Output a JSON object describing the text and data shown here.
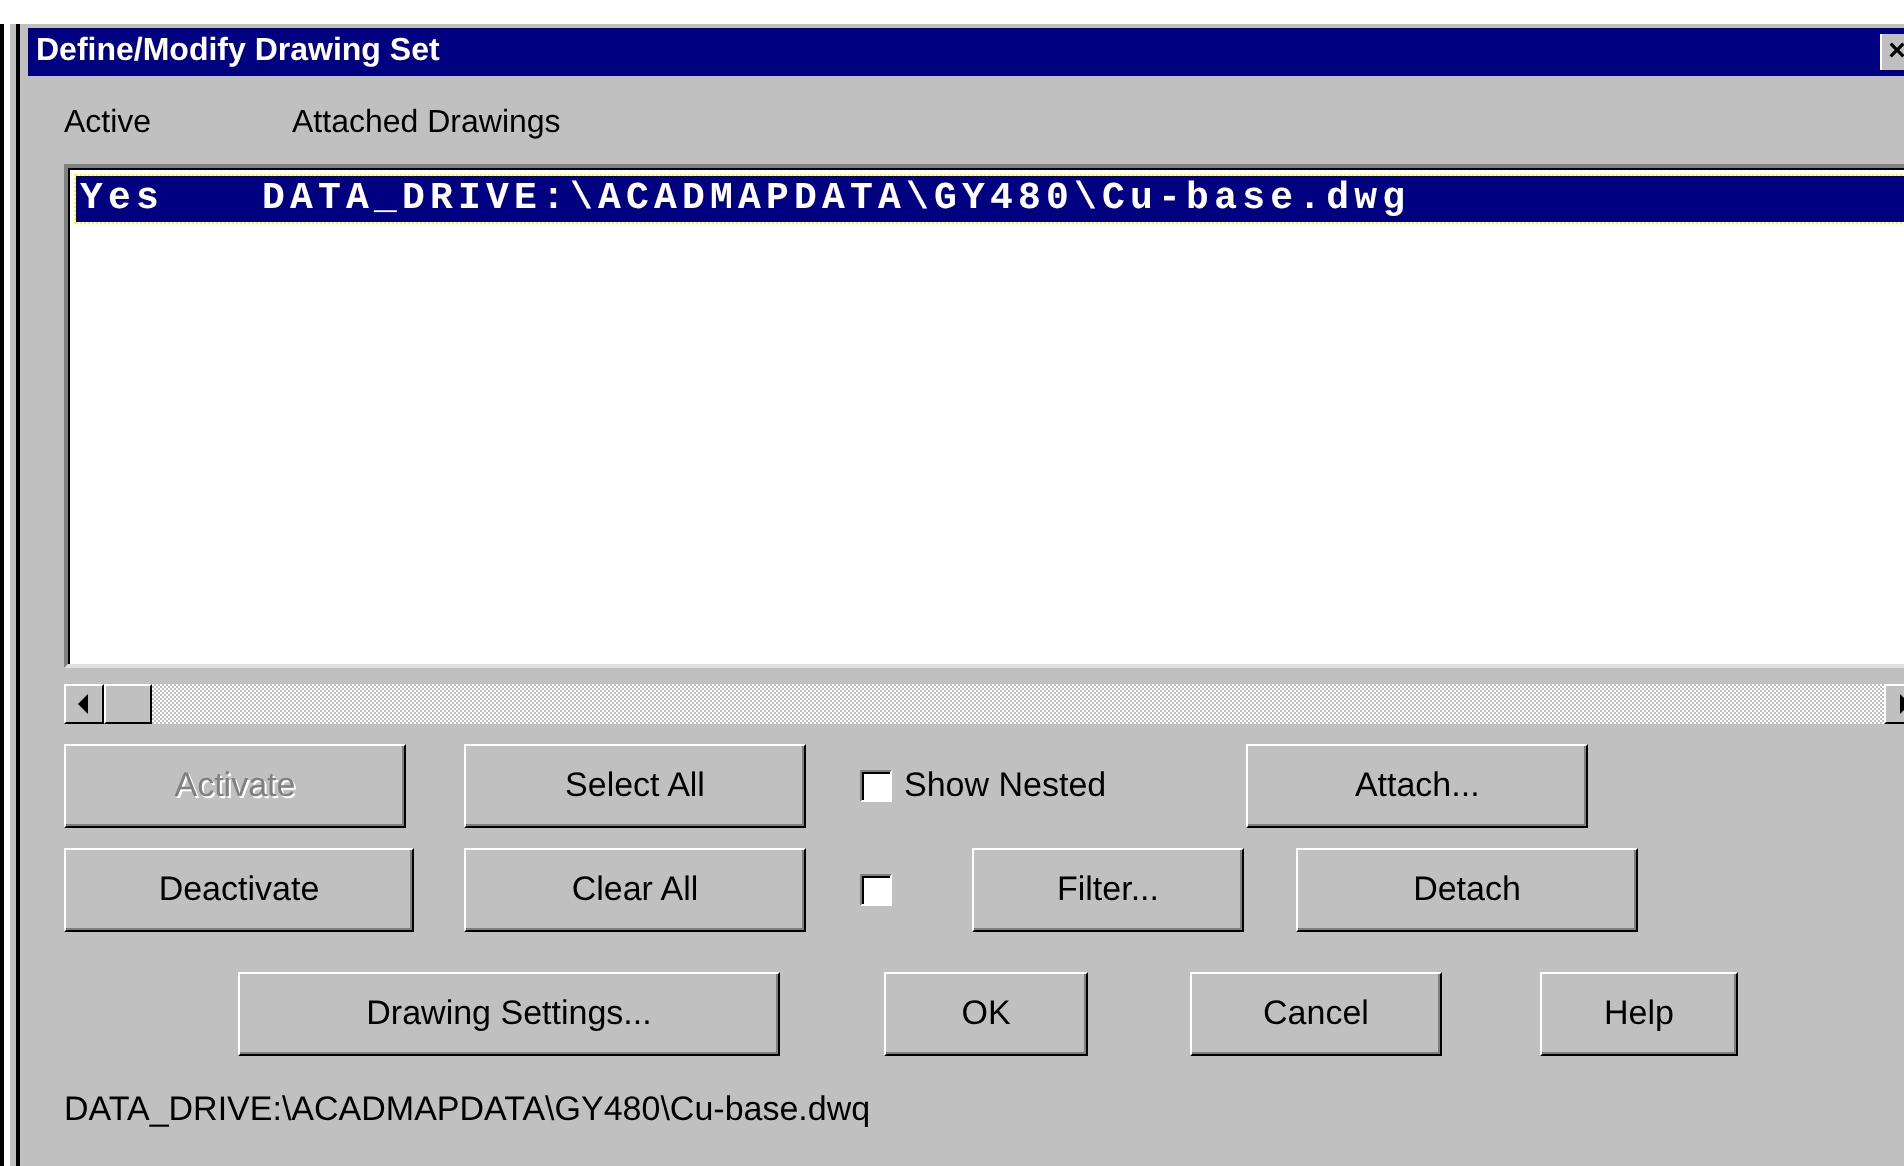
{
  "window": {
    "title": "Define/Modify Drawing Set",
    "close": "×"
  },
  "list": {
    "columns": [
      "Active",
      "Attached Drawings"
    ],
    "rows": [
      {
        "active": "Yes",
        "path": "DATA_DRIVE:\\ACADMAPDATA\\GY480\\Cu-base.dwg",
        "selected": true
      }
    ]
  },
  "controls": [
    [
      {
        "kind": "button",
        "label": "Activate",
        "disabled": true
      },
      {
        "kind": "button",
        "label": "Select All",
        "disabled": false
      },
      {
        "kind": "checkbox",
        "label": "Show Nested",
        "checked": false
      },
      {
        "kind": "button",
        "label": "Attach...",
        "disabled": false
      }
    ],
    [
      {
        "kind": "button",
        "label": "Deactivate",
        "disabled": false
      },
      {
        "kind": "button",
        "label": "Clear All",
        "disabled": false
      },
      {
        "kind": "checkbox",
        "checked": false
      },
      {
        "kind": "button",
        "label": "Filter...",
        "disabled": false
      },
      {
        "kind": "button",
        "label": "Detach",
        "disabled": false
      }
    ],
    [
      {
        "kind": "button",
        "label": "Drawing Settings...",
        "disabled": false
      },
      {
        "kind": "button",
        "label": "OK",
        "disabled": false
      },
      {
        "kind": "button",
        "label": "Cancel",
        "disabled": false
      },
      {
        "kind": "button",
        "label": "Help",
        "disabled": false
      }
    ]
  ],
  "status_bar": "DATA_DRIVE:\\ACADMAPDATA\\GY480\\Cu-base.dwq"
}
